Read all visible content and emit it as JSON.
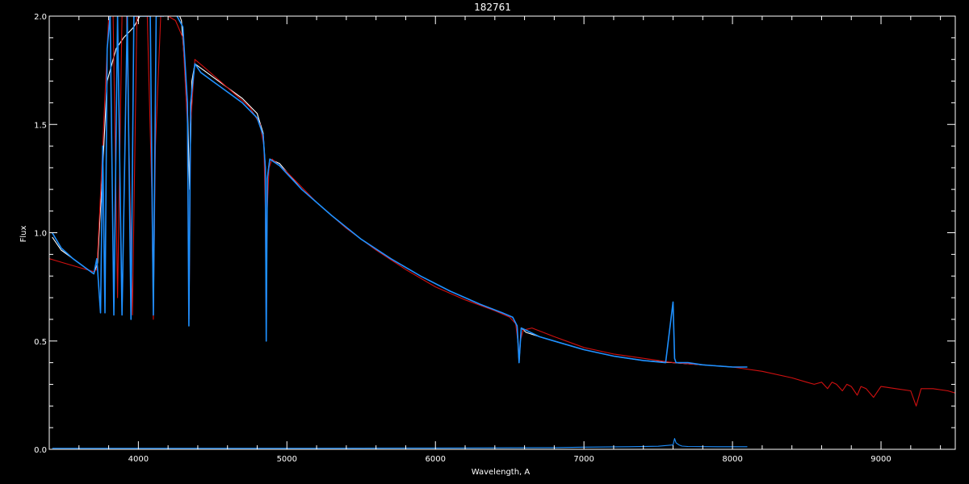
{
  "chart_data": {
    "type": "line",
    "title": "182761",
    "xlabel": "Wavelength, A",
    "ylabel": "Flux",
    "xlim": [
      3400,
      9500
    ],
    "ylim": [
      0.0,
      2.0
    ],
    "x_ticks": [
      4000,
      5000,
      6000,
      7000,
      8000,
      9000
    ],
    "x_tick_labels": [
      "4000",
      "5000",
      "6000",
      "7000",
      "8000",
      "9000"
    ],
    "y_ticks": [
      0.0,
      0.5,
      1.0,
      1.5,
      2.0
    ],
    "y_tick_labels": [
      "0.0",
      "0.5",
      "1.0",
      "1.5",
      "2.0"
    ],
    "grid": false,
    "colors": {
      "background": "#000000",
      "axes": "#ffffff",
      "observed": "#ffffff",
      "model": "#d01010",
      "fit": "#1e90ff"
    },
    "series": [
      {
        "key": "observed",
        "color": "#ffffff",
        "x": [
          3420,
          3480,
          3560,
          3640,
          3700,
          3725,
          3760,
          3790,
          3850,
          3900,
          3970,
          4050,
          4150,
          4250,
          4290,
          4330,
          4345,
          4360,
          4380,
          4420,
          4500,
          4600,
          4700,
          4800,
          4840,
          4855,
          4861,
          4868,
          4885,
          4950,
          5100,
          5300,
          5500,
          5700,
          5900,
          6100,
          6300,
          6450,
          6520,
          6550,
          6563,
          6578,
          6610,
          6700,
          6800,
          7000,
          7200,
          7400,
          7600,
          7800,
          8000,
          8100
        ],
        "y": [
          0.98,
          0.92,
          0.88,
          0.84,
          0.81,
          0.86,
          1.3,
          1.7,
          1.85,
          1.9,
          1.95,
          2.05,
          2.1,
          2.05,
          1.98,
          1.6,
          1.2,
          1.7,
          1.78,
          1.76,
          1.72,
          1.67,
          1.62,
          1.55,
          1.46,
          1.3,
          0.6,
          1.25,
          1.34,
          1.32,
          1.2,
          1.08,
          0.97,
          0.88,
          0.8,
          0.73,
          0.67,
          0.63,
          0.61,
          0.57,
          0.4,
          0.56,
          0.54,
          0.52,
          0.5,
          0.46,
          0.43,
          0.41,
          0.4,
          0.39,
          0.38,
          0.38
        ]
      },
      {
        "key": "model",
        "color": "#d01010",
        "x": [
          3400,
          3500,
          3600,
          3650,
          3700,
          3720,
          3740,
          3760,
          3780,
          3800,
          3830,
          3860,
          3890,
          3920,
          3960,
          3990,
          4020,
          4060,
          4090,
          4101,
          4115,
          4150,
          4200,
          4250,
          4300,
          4330,
          4341,
          4352,
          4380,
          4450,
          4550,
          4650,
          4750,
          4820,
          4845,
          4855,
          4861,
          4867,
          4880,
          4900,
          5000,
          5200,
          5400,
          5600,
          5800,
          6000,
          6200,
          6400,
          6500,
          6540,
          6555,
          6563,
          6571,
          6590,
          6650,
          6800,
          7000,
          7200,
          7400,
          7600,
          7800,
          8000,
          8200,
          8400,
          8500,
          8550,
          8600,
          8640,
          8670,
          8700,
          8740,
          8770,
          8800,
          8840,
          8865,
          8900,
          8950,
          9000,
          9100,
          9200,
          9237,
          9270,
          9350,
          9450,
          9500
        ],
        "y": [
          0.88,
          0.86,
          0.84,
          0.83,
          0.82,
          0.83,
          1.1,
          1.4,
          1.7,
          2.0,
          2.0,
          0.7,
          2.0,
          2.0,
          0.62,
          2.0,
          2.0,
          2.0,
          1.2,
          0.6,
          1.4,
          2.0,
          2.0,
          1.98,
          1.9,
          1.5,
          0.6,
          1.5,
          1.8,
          1.76,
          1.7,
          1.64,
          1.58,
          1.5,
          1.4,
          1.1,
          0.5,
          1.1,
          1.3,
          1.34,
          1.28,
          1.14,
          1.02,
          0.92,
          0.83,
          0.75,
          0.69,
          0.64,
          0.61,
          0.58,
          0.5,
          0.43,
          0.5,
          0.55,
          0.56,
          0.52,
          0.47,
          0.44,
          0.42,
          0.4,
          0.39,
          0.38,
          0.36,
          0.33,
          0.31,
          0.3,
          0.31,
          0.28,
          0.31,
          0.3,
          0.27,
          0.3,
          0.29,
          0.25,
          0.29,
          0.28,
          0.24,
          0.29,
          0.28,
          0.27,
          0.2,
          0.28,
          0.28,
          0.27,
          0.26
        ]
      },
      {
        "key": "fit",
        "color": "#1e90ff",
        "x": [
          3420,
          3480,
          3560,
          3640,
          3700,
          3720,
          3745,
          3760,
          3775,
          3790,
          3810,
          3835,
          3860,
          3890,
          3925,
          3950,
          3970,
          4000,
          4040,
          4080,
          4101,
          4120,
          4170,
          4220,
          4260,
          4300,
          4330,
          4340,
          4352,
          4380,
          4420,
          4500,
          4600,
          4700,
          4800,
          4840,
          4855,
          4861,
          4868,
          4885,
          4950,
          5100,
          5300,
          5500,
          5700,
          5900,
          6100,
          6300,
          6450,
          6520,
          6550,
          6563,
          6578,
          6610,
          6700,
          6800,
          7000,
          7200,
          7400,
          7550,
          7600,
          7610,
          7620,
          7640,
          7700,
          7800,
          8000,
          8100
        ],
        "y": [
          1.0,
          0.93,
          0.88,
          0.84,
          0.81,
          0.88,
          0.63,
          1.4,
          0.63,
          1.85,
          2.0,
          0.62,
          2.0,
          0.62,
          2.0,
          0.6,
          2.0,
          2.0,
          2.0,
          2.0,
          0.62,
          2.0,
          2.0,
          2.05,
          2.0,
          1.95,
          1.6,
          0.57,
          1.6,
          1.78,
          1.74,
          1.7,
          1.65,
          1.6,
          1.53,
          1.45,
          1.3,
          0.5,
          1.25,
          1.34,
          1.31,
          1.2,
          1.08,
          0.97,
          0.88,
          0.8,
          0.73,
          0.67,
          0.63,
          0.61,
          0.57,
          0.4,
          0.56,
          0.55,
          0.52,
          0.5,
          0.46,
          0.43,
          0.41,
          0.4,
          0.68,
          0.42,
          0.4,
          0.4,
          0.4,
          0.39,
          0.38,
          0.38
        ]
      },
      {
        "key": "fit-error",
        "color": "#1e90ff",
        "x": [
          3420,
          4000,
          5000,
          6000,
          6800,
          7000,
          7300,
          7500,
          7600,
          7610,
          7620,
          7640,
          7660,
          7700,
          7900,
          8100
        ],
        "y": [
          0.005,
          0.005,
          0.005,
          0.006,
          0.008,
          0.01,
          0.012,
          0.014,
          0.02,
          0.05,
          0.03,
          0.02,
          0.015,
          0.013,
          0.012,
          0.012
        ]
      }
    ]
  }
}
